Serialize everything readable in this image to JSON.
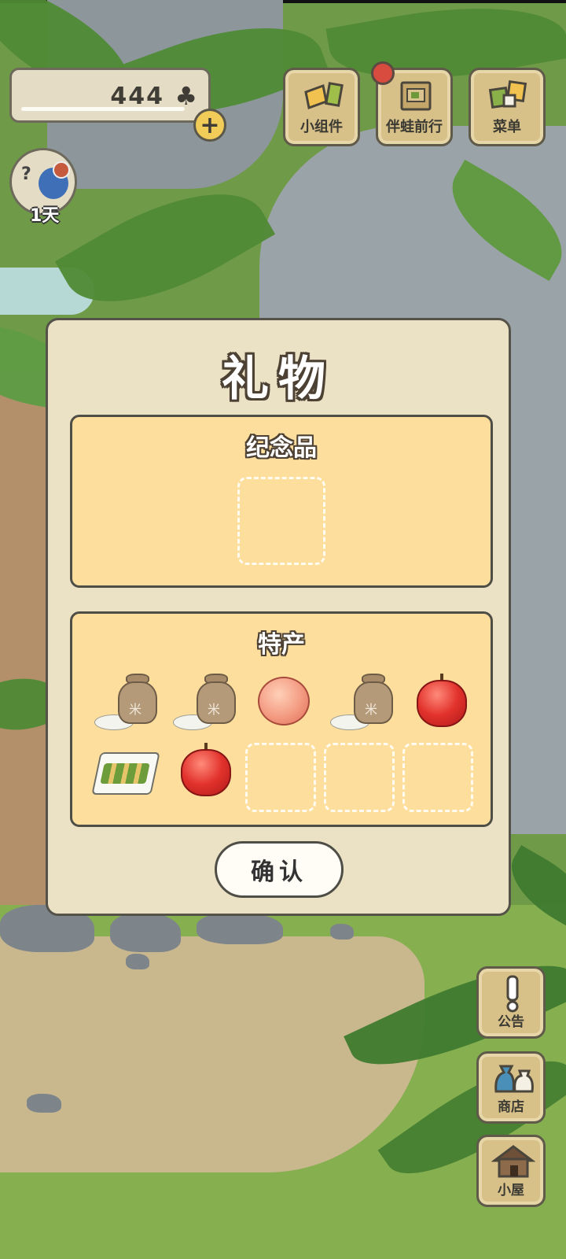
{
  "hud": {
    "clover_count": "444",
    "clover_icon": "clover-icon",
    "plus_icon": "+",
    "visitor_days": "1天"
  },
  "top_buttons": {
    "widgets_label": "小组件",
    "travel_label": "伴蛙前行",
    "menu_label": "菜单"
  },
  "side_buttons": {
    "notice_label": "公告",
    "shop_label": "商店",
    "house_label": "小屋"
  },
  "dialog": {
    "title": "礼物",
    "souvenir_title": "纪念品",
    "specialty_title": "特产",
    "specialty_items": [
      "rice-sack",
      "rice-sack",
      "peach",
      "rice-sack",
      "apple",
      "bento",
      "apple",
      "empty",
      "empty",
      "empty"
    ],
    "confirm_label": "确认"
  },
  "colors": {
    "panel_fill": "#fede9c",
    "dialog_fill": "#ebe2c6",
    "notification": "#d84b3f"
  }
}
